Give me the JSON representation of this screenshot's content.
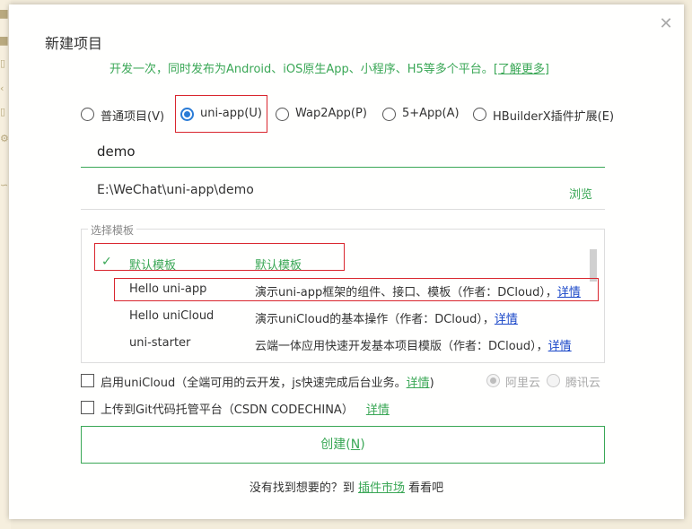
{
  "dialog": {
    "title": "新建项目",
    "close_icon": "close-icon",
    "subtitle_text": "开发一次，同时发布为Android、iOS原生App、小程序、H5等多个平台。",
    "subtitle_link": "[了解更多]"
  },
  "project_types": [
    {
      "label": "普通项目(V)",
      "selected": false
    },
    {
      "label": "uni-app(U)",
      "selected": true
    },
    {
      "label": "Wap2App(P)",
      "selected": false
    },
    {
      "label": "5+App(A)",
      "selected": false
    },
    {
      "label": "HBuilderX插件扩展(E)",
      "selected": false
    }
  ],
  "project_name": "demo",
  "project_path": "E:\\WeChat\\uni-app\\demo",
  "browse_label": "浏览",
  "templates": {
    "legend": "选择模板",
    "rows": [
      {
        "name": "默认模板",
        "desc": "默认模板",
        "detail": "",
        "selected": true
      },
      {
        "name": "Hello uni-app",
        "desc": "演示uni-app框架的组件、接口、模板（作者：DCloud），",
        "detail": "详情",
        "selected": false
      },
      {
        "name": "Hello uniCloud",
        "desc": "演示uniCloud的基本操作（作者：DCloud），",
        "detail": "详情",
        "selected": false
      },
      {
        "name": "uni-starter",
        "desc": "云端一体应用快速开发基本项目模版（作者：DCloud），",
        "detail": "详情",
        "selected": false
      }
    ]
  },
  "options": {
    "unicloud_label": "启用uniCloud（全端可用的云开发，js快速完成后台业务。",
    "unicloud_link": "详情",
    "unicloud_suffix": ")",
    "git_label": "上传到Git代码托管平台（CSDN CODECHINA）",
    "git_link": "详情",
    "cloud_providers": [
      "阿里云",
      "腾讯云"
    ]
  },
  "create_button": {
    "label": "创建(",
    "key": "N",
    "end": ")"
  },
  "footer": {
    "text": "没有找到想要的？到 ",
    "link": "插件市场",
    "suffix": " 看看吧"
  },
  "colors": {
    "accent": "#3aa756",
    "radio_selected": "#2a7bd6",
    "highlight_box": "#d9262e",
    "detail_link": "#1a47c8"
  }
}
